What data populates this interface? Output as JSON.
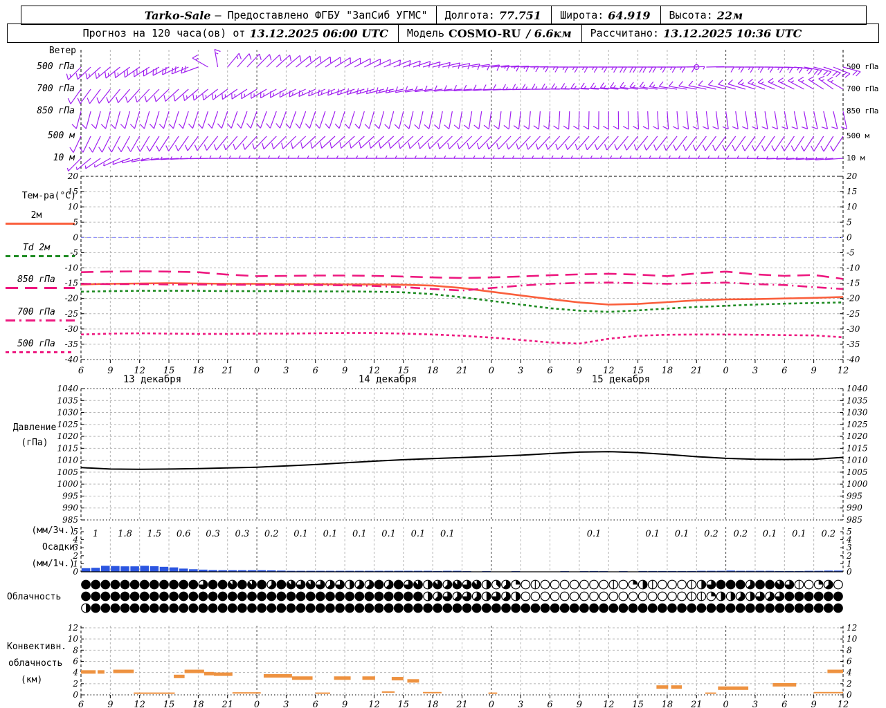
{
  "header": {
    "line1": {
      "title": "Tarko-Sale",
      "provided": "— Предоставлено ФГБУ \"ЗапСиб УГМС\"",
      "lon_label": "Долгота:",
      "lon": "77.751",
      "lat_label": "Широта:",
      "lat": "64.919",
      "alt_label": "Высота:",
      "alt": "22м"
    },
    "line2": {
      "forecast_label": "Прогноз на 120 часа(ов) от",
      "run_time": "13.12.2025 06:00 UTC",
      "model_label": "Модель",
      "model_name": "COSMO-RU",
      "model_res": "/ 6.6км",
      "calc_label": "Рассчитано:",
      "calc_time": "13.12.2025 10:36 UTC"
    }
  },
  "labels": {
    "wind_section": "Ветер",
    "wind_levels": [
      "500 гПа",
      "700 гПа",
      "850 гПа",
      "500 м",
      "10 м"
    ],
    "temp_title": "Тем-ра(°C)",
    "temp_legend": [
      "2м",
      "Td 2м",
      "850 гПа",
      "700 гПа",
      "500 гПа"
    ],
    "pressure_title_1": "Давление",
    "pressure_title_2": "(гПа)",
    "precip_unit_3h": "(мм/3ч.)",
    "precip_title": "Осадки",
    "precip_unit_1h": "(мм/1ч.)",
    "cloud_title": "Облачность",
    "conv_title_1": "Конвективн.",
    "conv_title_2": "облачность",
    "conv_title_3": "(км)",
    "dates": [
      "13 декабря",
      "14 декабря",
      "15 декабря"
    ]
  },
  "colors": {
    "wind_barb": "#A020F0",
    "temp_2m": "#FA5F3C",
    "dewpoint_2m": "#1E8B22",
    "temp_upper": "#ED187F",
    "pressure_line": "#000000",
    "precip_bar": "#2B55E0",
    "convective_bar": "#EE9240",
    "grid": "#B4B4B4",
    "day_grid": "#444444",
    "zero_line": "#8888FF"
  },
  "axes": {
    "hours_start": 0,
    "hours_end": 78,
    "hour_step": 3,
    "hour_labels": [
      "6",
      "9",
      "12",
      "15",
      "18",
      "21",
      "0",
      "3",
      "6",
      "9",
      "12",
      "15",
      "18",
      "21",
      "0",
      "3",
      "6",
      "9",
      "12",
      "15",
      "18",
      "21",
      "0",
      "3",
      "6",
      "9",
      "12"
    ],
    "temp_ticks": [
      20,
      15,
      10,
      5,
      0,
      -5,
      -10,
      -15,
      -20,
      -25,
      -30,
      -35,
      -40
    ],
    "pressure_ticks": [
      1040,
      1035,
      1030,
      1025,
      1020,
      1015,
      1010,
      1005,
      1000,
      995,
      990,
      985
    ],
    "precip_ticks": [
      0,
      1,
      2,
      3,
      4,
      5
    ],
    "conv_ticks": [
      0,
      2,
      4,
      6,
      8,
      10,
      12
    ],
    "date_centers_h": [
      7.3,
      31.4,
      55.3
    ]
  },
  "chart_data": [
    {
      "id": "wind_barbs",
      "type": "wind",
      "levels": [
        {
          "label": "500 гПа",
          "dirs": [
            225,
            230,
            235,
            242,
            250,
            40,
            45,
            50,
            55,
            60,
            65,
            70,
            75,
            80,
            85,
            88,
            90,
            90,
            90,
            90,
            90,
            88,
            90,
            90,
            92,
            105,
            115
          ],
          "spds": [
            18,
            18,
            20,
            20,
            22,
            15,
            12,
            12,
            10,
            10,
            10,
            12,
            12,
            14,
            15,
            15,
            18,
            18,
            20,
            20,
            18,
            0,
            15,
            15,
            18,
            22,
            25
          ]
        },
        {
          "label": "700 гПа",
          "dirs": [
            215,
            218,
            222,
            226,
            230,
            234,
            238,
            242,
            246,
            250,
            254,
            258,
            262,
            264,
            266,
            268,
            270,
            272,
            274,
            276,
            278,
            280,
            284,
            288,
            294,
            300,
            308
          ],
          "spds": [
            12,
            12,
            14,
            14,
            15,
            15,
            15,
            16,
            16,
            16,
            15,
            15,
            14,
            14,
            14,
            15,
            15,
            16,
            16,
            15,
            15,
            14,
            14,
            15,
            16,
            18,
            18
          ]
        },
        {
          "label": "850 гПа",
          "dirs": [
            195,
            195,
            196,
            197,
            198,
            199,
            200,
            200,
            199,
            198,
            196,
            194,
            192,
            190,
            188,
            186,
            184,
            182,
            180,
            178,
            176,
            174,
            172,
            172,
            170,
            168,
            166
          ],
          "spds": [
            10,
            10,
            12,
            12,
            12,
            14,
            14,
            14,
            13,
            12,
            12,
            12,
            12,
            12,
            12,
            10,
            10,
            10,
            10,
            10,
            10,
            10,
            12,
            12,
            12,
            14,
            14
          ]
        },
        {
          "label": "500 м",
          "dirs": [
            205,
            207,
            210,
            213,
            216,
            219,
            222,
            225,
            227,
            228,
            228,
            227,
            226,
            225,
            224,
            223,
            222,
            221,
            220,
            219,
            218,
            217,
            216,
            215,
            214,
            213,
            212
          ],
          "spds": [
            10,
            10,
            12,
            12,
            14,
            14,
            14,
            14,
            13,
            12,
            12,
            12,
            10,
            10,
            10,
            10,
            10,
            10,
            10,
            10,
            10,
            10,
            10,
            12,
            12,
            12,
            12
          ]
        },
        {
          "label": "10 м",
          "dirs": [
            225,
            240,
            255,
            265,
            268,
            270,
            270,
            270,
            270,
            270,
            270,
            270,
            270,
            270,
            270,
            270,
            270,
            270,
            270,
            270,
            270,
            270,
            270,
            270,
            268,
            266,
            264
          ],
          "spds": [
            8,
            8,
            8,
            8,
            8,
            8,
            8,
            8,
            8,
            8,
            6,
            6,
            6,
            6,
            6,
            6,
            6,
            8,
            8,
            8,
            8,
            8,
            8,
            8,
            8,
            8,
            8
          ]
        }
      ]
    },
    {
      "id": "temperature",
      "type": "line",
      "title": "Тем-ра(°C)",
      "ylim": [
        -40,
        20
      ],
      "ytick_step": 5,
      "x_start_hour": 0,
      "x_step_hours": 3,
      "series": [
        {
          "name": "2м",
          "style": "solid",
          "color_key": "temp_2m",
          "values": [
            -15.4,
            -15.2,
            -15.1,
            -15.0,
            -15.1,
            -15.2,
            -15.2,
            -15.3,
            -15.3,
            -15.4,
            -15.4,
            -15.5,
            -15.8,
            -16.6,
            -17.8,
            -19.0,
            -20.2,
            -21.3,
            -22.0,
            -21.8,
            -21.2,
            -20.6,
            -20.3,
            -20.2,
            -20.0,
            -19.8,
            -19.5
          ]
        },
        {
          "name": "Td 2м",
          "style": "dot",
          "color_key": "dewpoint_2m",
          "values": [
            -17.8,
            -17.6,
            -17.5,
            -17.5,
            -17.5,
            -17.6,
            -17.6,
            -17.6,
            -17.7,
            -17.7,
            -17.8,
            -18.0,
            -18.6,
            -19.6,
            -20.8,
            -22.0,
            -23.2,
            -24.0,
            -24.4,
            -23.9,
            -23.3,
            -22.8,
            -22.4,
            -22.0,
            -21.7,
            -21.5,
            -21.3
          ]
        },
        {
          "name": "850 гПа",
          "style": "longdash",
          "color_key": "temp_upper",
          "values": [
            -11.4,
            -11.2,
            -11.1,
            -11.2,
            -11.4,
            -12.2,
            -12.7,
            -12.6,
            -12.5,
            -12.5,
            -12.6,
            -12.8,
            -13.1,
            -13.3,
            -13.1,
            -12.8,
            -12.4,
            -12.1,
            -11.9,
            -12.2,
            -12.7,
            -11.8,
            -11.2,
            -12.1,
            -12.6,
            -12.3,
            -13.6
          ]
        },
        {
          "name": "700 гПа",
          "style": "dashdot",
          "color_key": "temp_upper",
          "values": [
            -15.2,
            -15.3,
            -15.3,
            -15.4,
            -15.4,
            -15.5,
            -15.5,
            -15.6,
            -15.6,
            -15.7,
            -15.9,
            -16.3,
            -16.9,
            -17.4,
            -16.6,
            -15.8,
            -15.2,
            -14.9,
            -14.8,
            -15.0,
            -15.2,
            -15.0,
            -14.8,
            -15.3,
            -15.6,
            -16.3,
            -16.9
          ]
        },
        {
          "name": "500 гПа",
          "style": "dot",
          "color_key": "temp_upper",
          "values": [
            -31.8,
            -31.5,
            -31.4,
            -31.5,
            -31.6,
            -31.6,
            -31.5,
            -31.5,
            -31.4,
            -31.3,
            -31.3,
            -31.5,
            -31.8,
            -32.2,
            -32.8,
            -33.6,
            -34.4,
            -34.8,
            -33.2,
            -32.2,
            -31.9,
            -31.8,
            -31.8,
            -31.9,
            -32.0,
            -32.1,
            -32.7
          ]
        }
      ]
    },
    {
      "id": "pressure",
      "type": "line",
      "title": "Давление (гПа)",
      "ylim": [
        985,
        1040
      ],
      "ytick_step": 5,
      "x_start_hour": 0,
      "x_step_hours": 3,
      "values": [
        1006.9,
        1006.3,
        1006.2,
        1006.3,
        1006.5,
        1006.8,
        1007.1,
        1007.6,
        1008.2,
        1008.9,
        1009.6,
        1010.2,
        1010.7,
        1011.1,
        1011.6,
        1012.1,
        1012.8,
        1013.4,
        1013.6,
        1013.2,
        1012.4,
        1011.5,
        1010.8,
        1010.4,
        1010.3,
        1010.4,
        1011.2
      ]
    },
    {
      "id": "precip_1h",
      "type": "bar",
      "title": "Осадки (мм/1ч.)",
      "ylim": [
        0,
        5
      ],
      "values": [
        0.45,
        0.5,
        0.75,
        0.72,
        0.68,
        0.68,
        0.75,
        0.7,
        0.62,
        0.55,
        0.4,
        0.32,
        0.27,
        0.22,
        0.2,
        0.2,
        0.2,
        0.2,
        0.2,
        0.18,
        0.15,
        0.12,
        0.12,
        0.12,
        0.12,
        0.12,
        0.12,
        0.12,
        0.12,
        0.12,
        0.12,
        0.12,
        0.12,
        0.12,
        0.12,
        0.12,
        0.1,
        0.12,
        0.12,
        0.08,
        0,
        0.08,
        0,
        0,
        0.08,
        0,
        0,
        0,
        0,
        0.08,
        0,
        0.08,
        0.1,
        0.08,
        0,
        0.08,
        0,
        0.1,
        0.1,
        0.1,
        0.1,
        0.1,
        0.1,
        0.12,
        0.12,
        0.12,
        0.15,
        0.12,
        0.12,
        0.12,
        0.12,
        0.1,
        0.1,
        0.1,
        0.12,
        0.12,
        0.15,
        0.15
      ]
    },
    {
      "id": "precip_3h_sums",
      "type": "labels",
      "title": "Осадки (мм/3ч.)",
      "values": [
        "1",
        "1.8",
        "1.5",
        "0.6",
        "0.3",
        "0.3",
        "0.2",
        "0.1",
        "0.1",
        "0.1",
        "0.1",
        "0.1",
        "0.1",
        "",
        "",
        "",
        "",
        "0.1",
        "",
        "0.1",
        "0.1",
        "0.2",
        "0.2",
        "0.1",
        "0.1",
        "0.2"
      ]
    },
    {
      "id": "cloud_cover",
      "type": "symbols",
      "title": "Облачность",
      "okta_max": 8,
      "rows": [
        [
          8,
          8,
          8,
          8,
          8,
          8,
          8,
          8,
          8,
          8,
          8,
          8,
          6,
          8,
          8,
          7,
          8,
          7,
          8,
          5,
          8,
          7,
          6,
          7,
          6,
          5,
          6,
          4,
          5,
          5,
          8,
          5,
          8,
          6,
          7,
          4,
          7,
          5,
          7,
          6,
          7,
          4,
          3,
          5,
          2,
          0,
          1,
          0,
          0,
          0,
          0,
          0,
          0,
          0,
          1,
          0,
          2,
          4,
          1,
          0,
          0,
          0,
          1,
          4,
          6,
          8,
          8,
          8,
          5,
          8,
          8,
          7,
          6,
          1,
          0,
          2,
          5,
          0
        ],
        [
          8,
          8,
          8,
          8,
          8,
          8,
          8,
          8,
          8,
          8,
          8,
          8,
          8,
          8,
          8,
          8,
          8,
          8,
          8,
          8,
          8,
          8,
          8,
          8,
          8,
          8,
          8,
          8,
          8,
          8,
          8,
          8,
          8,
          8,
          8,
          4,
          5,
          6,
          5,
          6,
          5,
          4,
          6,
          5,
          4,
          0,
          0,
          0,
          0,
          0,
          0,
          0,
          0,
          0,
          0,
          0,
          0,
          0,
          0,
          0,
          0,
          0,
          1,
          1,
          2,
          4,
          4,
          5,
          4,
          6,
          5,
          6,
          8,
          8,
          8,
          8,
          8,
          8
        ],
        [
          4,
          8,
          8,
          8,
          8,
          8,
          8,
          8,
          8,
          8,
          8,
          8,
          8,
          8,
          8,
          8,
          8,
          8,
          8,
          8,
          8,
          8,
          8,
          8,
          8,
          8,
          8,
          8,
          8,
          8,
          8,
          8,
          8,
          8,
          8,
          8,
          8,
          8,
          8,
          8,
          8,
          8,
          8,
          8,
          8,
          8,
          8,
          8,
          8,
          8,
          8,
          8,
          8,
          8,
          8,
          8,
          8,
          8,
          8,
          8,
          8,
          8,
          8,
          8,
          8,
          8,
          8,
          8,
          8,
          8,
          8,
          8,
          8,
          8,
          8,
          8,
          8,
          8
        ]
      ]
    },
    {
      "id": "convective_cloud",
      "type": "segments",
      "title": "Конвективн. облачность (км)",
      "ylim": [
        0,
        13
      ],
      "segments": [
        [
          0,
          1.5,
          4.1,
          1
        ],
        [
          1.7,
          2.4,
          4.1,
          1
        ],
        [
          3.3,
          5.4,
          4.2,
          1
        ],
        [
          5.4,
          9.6,
          0.3,
          0
        ],
        [
          9.5,
          10.6,
          3.3,
          1
        ],
        [
          10.6,
          12.6,
          4.2,
          1
        ],
        [
          12.6,
          13.6,
          3.8,
          1
        ],
        [
          13.6,
          15.5,
          3.7,
          1
        ],
        [
          15.5,
          18.4,
          0.35,
          0
        ],
        [
          18.7,
          21.6,
          3.4,
          1
        ],
        [
          21.6,
          23.7,
          3.0,
          1
        ],
        [
          24.0,
          25.5,
          0.3,
          0
        ],
        [
          25.9,
          27.6,
          3.0,
          1
        ],
        [
          28.8,
          30.1,
          3.0,
          1
        ],
        [
          30.8,
          32.1,
          0.5,
          0
        ],
        [
          31.8,
          33.0,
          2.9,
          1
        ],
        [
          33.4,
          34.6,
          2.5,
          1
        ],
        [
          35.0,
          36.9,
          0.4,
          0
        ],
        [
          41.7,
          42.6,
          0.3,
          0
        ],
        [
          58.9,
          60.1,
          1.4,
          1
        ],
        [
          60.4,
          61.5,
          1.4,
          1
        ],
        [
          63.9,
          65.0,
          0.3,
          0
        ],
        [
          65.2,
          68.3,
          1.2,
          1
        ],
        [
          70.8,
          73.2,
          1.8,
          1
        ],
        [
          75.0,
          78.0,
          0.4,
          0
        ],
        [
          76.4,
          78.0,
          4.2,
          1
        ]
      ]
    }
  ]
}
